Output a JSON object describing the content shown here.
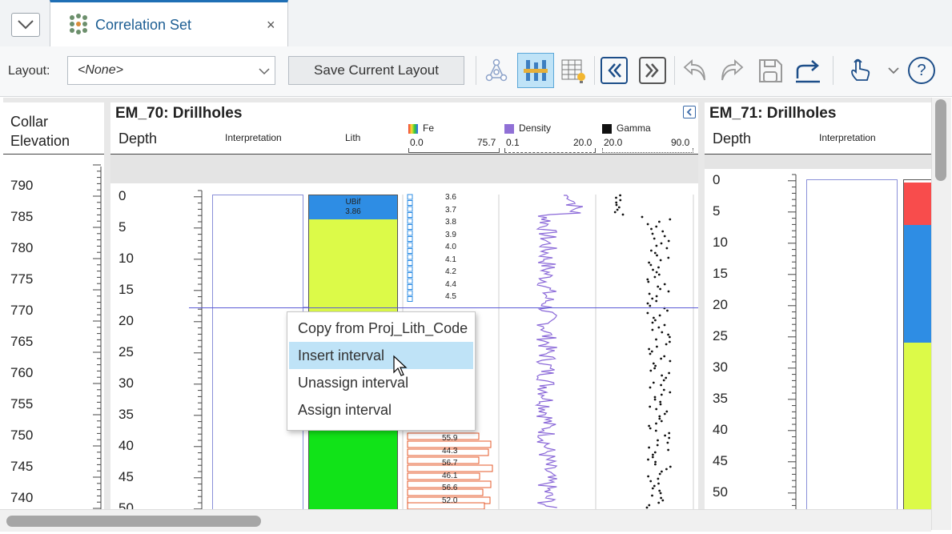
{
  "tab": {
    "title": "Correlation Set",
    "close": "×",
    "dropdown_icon": "chevron-down-icon",
    "tab_icon": "correlation-set-icon"
  },
  "toolbar": {
    "layout_label": "Layout:",
    "layout_value": "<None>",
    "save_label": "Save Current Layout",
    "icons": [
      "network-icon",
      "column-layout-icon",
      "table-lightbulb-icon",
      "first-icon",
      "last-icon",
      "undo-icon",
      "redo-icon",
      "save-icon",
      "export-icon",
      "touch-icon",
      "more-chevron-icon",
      "help-icon"
    ],
    "help": "?"
  },
  "left": {
    "header_line1": "Collar",
    "header_line2": "Elevation",
    "ticks": [
      "790",
      "785",
      "780",
      "775",
      "770",
      "765",
      "760",
      "755",
      "750",
      "745",
      "740"
    ]
  },
  "em70": {
    "title": "EM_70: Drillholes",
    "depth_label": "Depth",
    "interp_label": "Interpretation",
    "lith_label": "Lith",
    "fe": {
      "name": "Fe",
      "min": "0.0",
      "max": "75.7",
      "color": "#f6c23a"
    },
    "density": {
      "name": "Density",
      "min": "0.1",
      "max": "20.0",
      "color": "#9070d6"
    },
    "gamma": {
      "name": "Gamma",
      "min": "20.0",
      "max": "90.0",
      "color": "#111111"
    },
    "depth_ticks": [
      "0",
      "5",
      "10",
      "15",
      "20",
      "25",
      "30",
      "35",
      "40",
      "45",
      "50"
    ],
    "lith_top": {
      "code": "UBif",
      "depth": "3.86",
      "color": "#2e8de4"
    },
    "fe_upper": [
      "3.6",
      "3.7",
      "3.8",
      "3.9",
      "4.0",
      "4.1",
      "4.2",
      "4.4",
      "4.5"
    ],
    "fe_lower": [
      "55.9",
      "44.3",
      "56.7",
      "46.1",
      "56.6",
      "52.0"
    ]
  },
  "em71": {
    "title": "EM_71: Drillholes",
    "depth_label": "Depth",
    "interp_label": "Interpretation",
    "depth_ticks": [
      "0",
      "5",
      "10",
      "15",
      "20",
      "25",
      "30",
      "35",
      "40",
      "45",
      "50"
    ]
  },
  "context_menu": {
    "items": [
      {
        "label": "Copy from Proj_Lith_Code",
        "highlighted": false
      },
      {
        "label": "Insert interval",
        "highlighted": true
      },
      {
        "label": "Unassign interval",
        "highlighted": false
      },
      {
        "label": "Assign interval",
        "highlighted": false
      }
    ]
  },
  "collapse_icon": "collapse-left-icon"
}
